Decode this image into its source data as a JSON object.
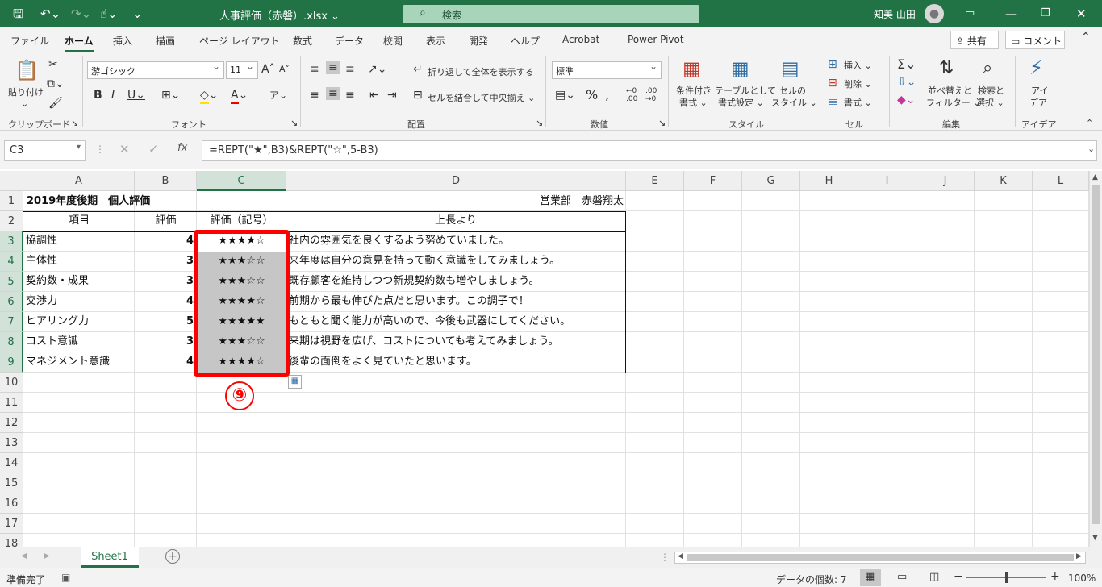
{
  "window": {
    "title": "人事評価（赤磐）.xlsx",
    "search_placeholder": "検索",
    "user": "知美 山田"
  },
  "tabs": [
    "ファイル",
    "ホーム",
    "挿入",
    "描画",
    "ページ レイアウト",
    "数式",
    "データ",
    "校閲",
    "表示",
    "開発",
    "ヘルプ",
    "Acrobat",
    "Power Pivot"
  ],
  "share": {
    "share": "共有",
    "comment": "コメント"
  },
  "ribbon": {
    "paste": "貼り付け",
    "clipboard": "クリップボード",
    "font_name": "游ゴシック",
    "font_size": "11",
    "font": "フォント",
    "wrap": "折り返して全体を表示する",
    "merge": "セルを結合して中央揃え",
    "align": "配置",
    "numfmt": "標準",
    "number": "数値",
    "cond1": "条件付き",
    "cond2": "書式 ⌄",
    "table1": "テーブルとして",
    "table2": "書式設定 ⌄",
    "cellstyle1": "セルの",
    "cellstyle2": "スタイル ⌄",
    "styles": "スタイル",
    "insert": "挿入",
    "delete": "削除",
    "format": "書式",
    "cells": "セル",
    "sort1": "並べ替えと",
    "sort2": "フィルター ⌄",
    "find1": "検索と",
    "find2": "選択 ⌄",
    "editing": "編集",
    "idea1": "アイ",
    "idea2": "デア",
    "ideas": "アイデア"
  },
  "formula_bar": {
    "name_box": "C3",
    "formula": "=REPT(\"★\",B3)&REPT(\"☆\",5-B3)"
  },
  "columns": [
    "A",
    "B",
    "C",
    "D",
    "E",
    "F",
    "G",
    "H",
    "I",
    "J",
    "K",
    "L"
  ],
  "rows": [
    "1",
    "2",
    "3",
    "4",
    "5",
    "6",
    "7",
    "8",
    "9",
    "10",
    "11",
    "12",
    "13",
    "14",
    "15",
    "16",
    "17",
    "18"
  ],
  "sheet": {
    "title": "2019年度後期　個人評価",
    "dept": "営業部　赤磐翔太",
    "headers": [
      "項目",
      "評価",
      "評価（記号）",
      "上長より"
    ],
    "data": [
      {
        "item": "協調性",
        "score": "4",
        "stars": "★★★★☆",
        "comment": "社内の雰囲気を良くするよう努めていました。"
      },
      {
        "item": "主体性",
        "score": "3",
        "stars": "★★★☆☆",
        "comment": "来年度は自分の意見を持って動く意識をしてみましょう。"
      },
      {
        "item": "契約数・成果",
        "score": "3",
        "stars": "★★★☆☆",
        "comment": "既存顧客を維持しつつ新規契約数も増やしましょう。"
      },
      {
        "item": "交渉力",
        "score": "4",
        "stars": "★★★★☆",
        "comment": "前期から最も伸びた点だと思います。この調子で！"
      },
      {
        "item": "ヒアリング力",
        "score": "5",
        "stars": "★★★★★",
        "comment": "もともと聞く能力が高いので、今後も武器にしてください。"
      },
      {
        "item": "コスト意識",
        "score": "3",
        "stars": "★★★☆☆",
        "comment": "来期は視野を広げ、コストについても考えてみましょう。"
      },
      {
        "item": "マネジメント意識",
        "score": "4",
        "stars": "★★★★☆",
        "comment": "後輩の面倒をよく見ていたと思います。"
      }
    ]
  },
  "annotation": "⑨",
  "sheet_tab": "Sheet1",
  "status": {
    "ready": "準備完了",
    "count": "データの個数: 7",
    "zoom": "100%"
  }
}
